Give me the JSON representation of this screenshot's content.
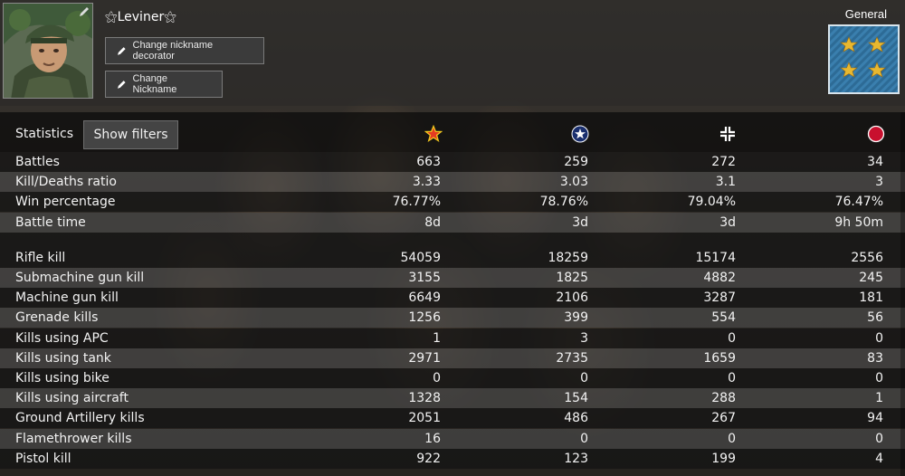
{
  "player": {
    "nickname": "Leviner",
    "change_decorator_label": "Change nickname decorator",
    "change_nickname_label": "Change Nickname",
    "rank": "General"
  },
  "stats": {
    "title": "Statistics",
    "filter_label": "Show filters",
    "factions": [
      "ussr-star-icon",
      "usa-star-icon",
      "germany-cross-icon",
      "japan-circle-icon"
    ],
    "group1": [
      {
        "label": "Battles",
        "values": [
          "663",
          "259",
          "272",
          "34"
        ]
      },
      {
        "label": "Kill/Deaths ratio",
        "values": [
          "3.33",
          "3.03",
          "3.1",
          "3"
        ]
      },
      {
        "label": "Win percentage",
        "values": [
          "76.77%",
          "78.76%",
          "79.04%",
          "76.47%"
        ]
      },
      {
        "label": "Battle time",
        "values": [
          "8d",
          "3d",
          "3d",
          "9h 50m"
        ]
      }
    ],
    "group2": [
      {
        "label": "Rifle kill",
        "values": [
          "54059",
          "18259",
          "15174",
          "2556"
        ]
      },
      {
        "label": "Submachine gun kill",
        "values": [
          "3155",
          "1825",
          "4882",
          "245"
        ]
      },
      {
        "label": "Machine gun kill",
        "values": [
          "6649",
          "2106",
          "3287",
          "181"
        ]
      },
      {
        "label": "Grenade kills",
        "values": [
          "1256",
          "399",
          "554",
          "56"
        ]
      },
      {
        "label": "Kills using APC",
        "values": [
          "1",
          "3",
          "0",
          "0"
        ]
      },
      {
        "label": "Kills using tank",
        "values": [
          "2971",
          "2735",
          "1659",
          "83"
        ]
      },
      {
        "label": "Kills using bike",
        "values": [
          "0",
          "0",
          "0",
          "0"
        ]
      },
      {
        "label": "Kills using aircraft",
        "values": [
          "1328",
          "154",
          "288",
          "1"
        ]
      },
      {
        "label": "Ground Artillery kills",
        "values": [
          "2051",
          "486",
          "267",
          "94"
        ]
      },
      {
        "label": "Flamethrower kills",
        "values": [
          "16",
          "0",
          "0",
          "0"
        ]
      },
      {
        "label": "Pistol kill",
        "values": [
          "922",
          "123",
          "199",
          "4"
        ]
      }
    ]
  },
  "colors": {
    "ussr": "#e8c020",
    "usa": "#1a2f6e",
    "germany": "#ffffff",
    "japan": "#c8102e"
  }
}
